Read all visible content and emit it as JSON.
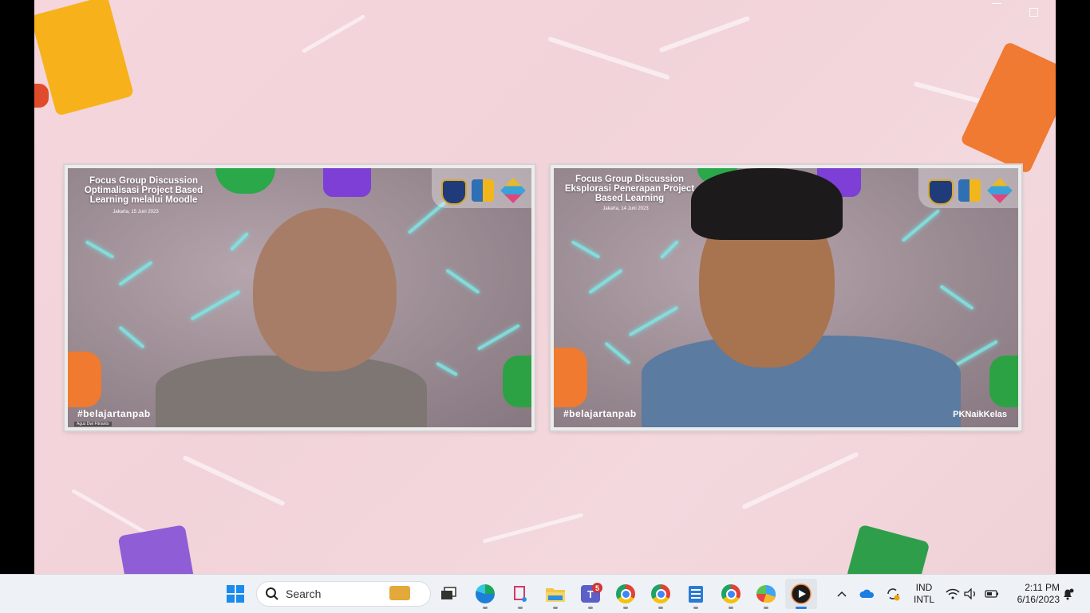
{
  "window": {
    "minimize_label": "",
    "maximize_label": "",
    "close_label": "✕"
  },
  "tiles": [
    {
      "title_line1": "Focus Group Discussion",
      "title_line2": "Optimalisasi Project Based",
      "title_line3": "Learning melalui Moodle",
      "date": "Jakarta, 15 Juni 2023",
      "hashtag": "#belajartanpab",
      "name_caption": "Agus Dwi Fitrianto"
    },
    {
      "title_line1": "Focus Group Discussion",
      "title_line2": "Eksplorasi Penerapan Project",
      "title_line3": "Based Learning",
      "date": "Jakarta, 14 Juni 2023",
      "hashtag": "#belajartanpab",
      "tag_right": "PKNaikKelas"
    }
  ],
  "taskbar": {
    "search_placeholder": "Search",
    "teams_badge": "5",
    "lang_line1": "IND",
    "lang_line2": "INTL",
    "time": "2:11 PM",
    "date": "6/16/2023"
  },
  "colors": {
    "background_pink": "#f3d7dd",
    "neon": "#7fe9e6",
    "taskbar": "#eef1f6"
  }
}
